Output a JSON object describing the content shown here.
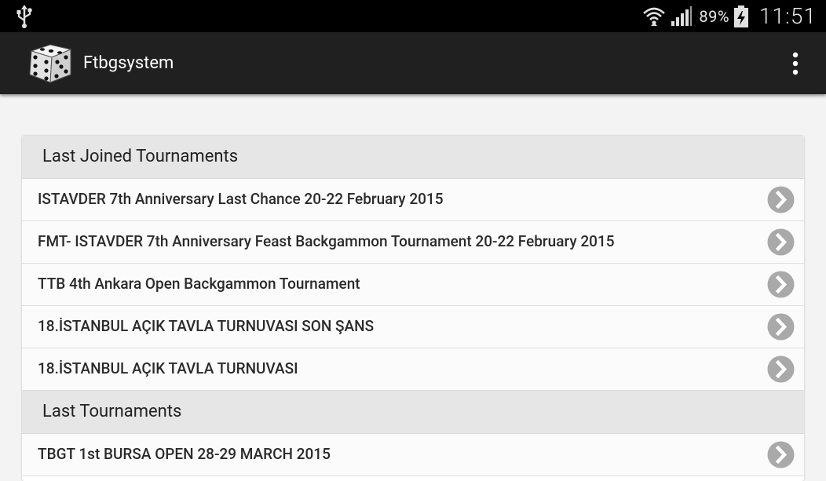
{
  "status_bar": {
    "battery_percent": "89%",
    "time": "11:51",
    "icons": [
      "usb-icon",
      "wifi-icon",
      "signal-icon",
      "battery-charging-icon"
    ]
  },
  "action_bar": {
    "title": "Ftbgsystem",
    "logo_icon": "dice-icon",
    "menu_icon": "overflow-menu-icon"
  },
  "sections": [
    {
      "title": "Last Joined Tournaments",
      "items": [
        "ISTAVDER 7th Anniversary Last Chance 20-22 February 2015",
        "FMT- ISTAVDER 7th Anniversary Feast Backgammon Tournament 20-22 February 2015",
        "TTB 4th Ankara Open Backgammon Tournament",
        "18.İSTANBUL AÇIK TAVLA TURNUVASI SON ŞANS",
        "18.İSTANBUL AÇIK TAVLA TURNUVASI"
      ]
    },
    {
      "title": "Last Tournaments",
      "items": [
        "TBGT 1st BURSA OPEN 28-29 MARCH 2015"
      ]
    }
  ],
  "colors": {
    "status_bar_bg": "#000000",
    "action_bar_bg": "#202020",
    "section_header_bg": "#e6e6e6",
    "chevron_circle": "#a9a9a9"
  }
}
